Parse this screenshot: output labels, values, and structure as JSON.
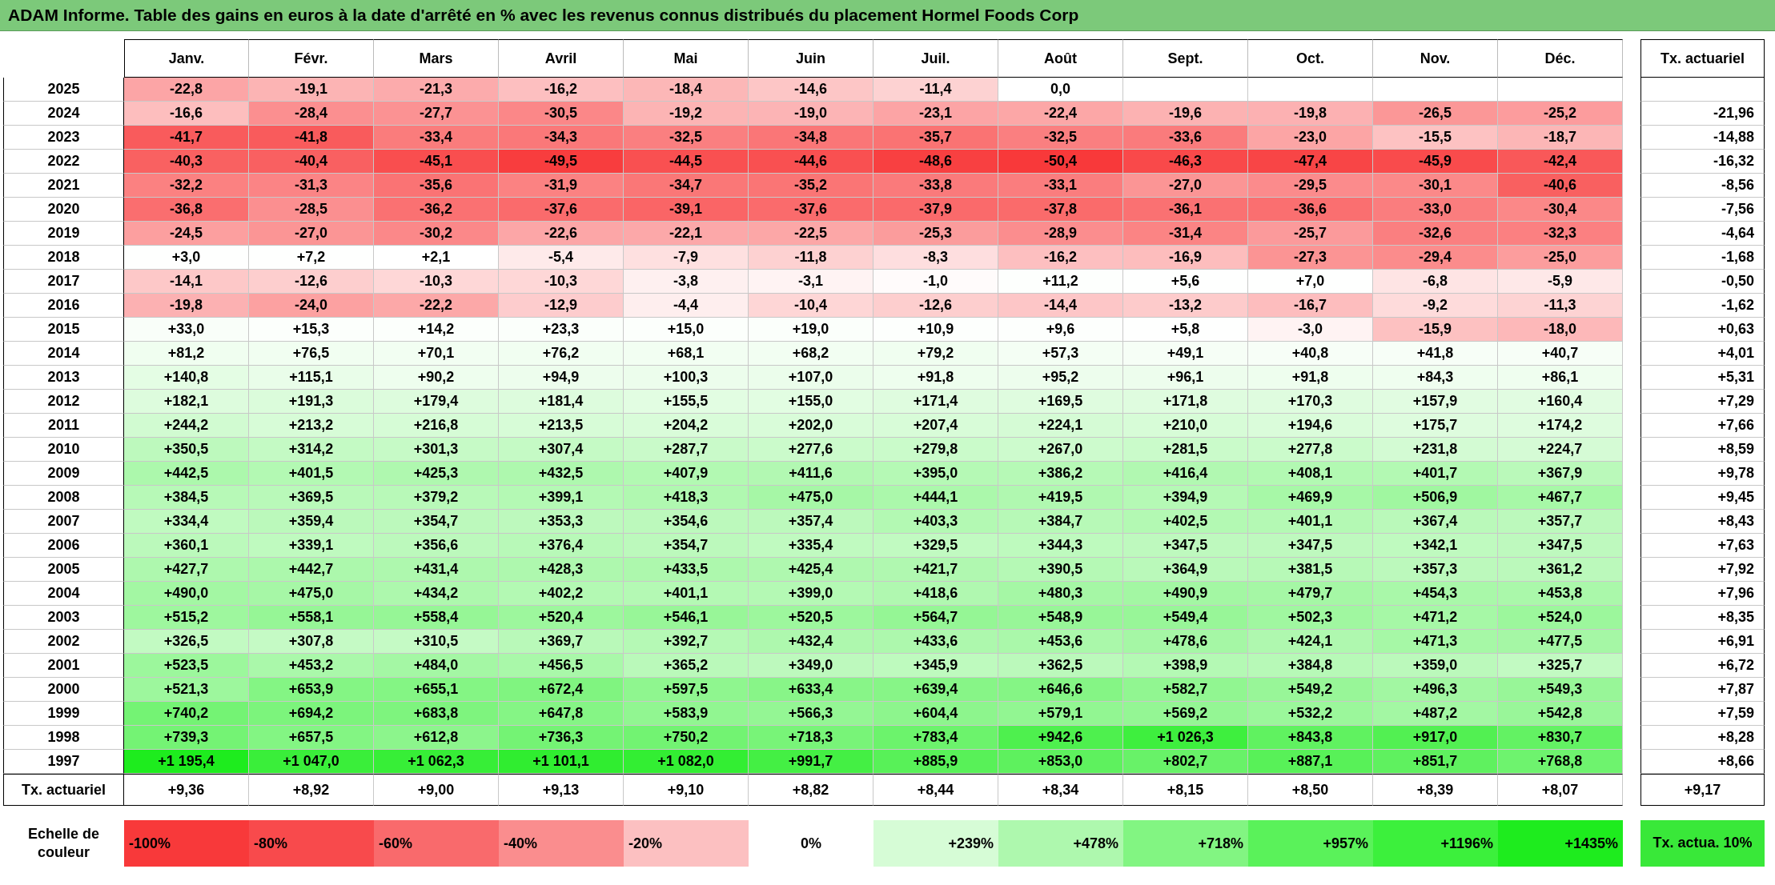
{
  "title": "ADAM Informe. Table des gains en euros à la date d'arrêté en % avec les revenus connus distribués du placement Hormel Foods Corp",
  "columns": [
    "Janv.",
    "Févr.",
    "Mars",
    "Avril",
    "Mai",
    "Juin",
    "Juil.",
    "Août",
    "Sept.",
    "Oct.",
    "Nov.",
    "Déc."
  ],
  "rate_header": "Tx. actuariel",
  "rows": [
    {
      "year": "2025",
      "values": [
        "-22,8",
        "-19,1",
        "-21,3",
        "-16,2",
        "-18,4",
        "-14,6",
        "-11,4",
        "0,0"
      ]
    },
    {
      "year": "2024",
      "values": [
        "-16,6",
        "-28,4",
        "-27,7",
        "-30,5",
        "-19,2",
        "-19,0",
        "-23,1",
        "-22,4",
        "-19,6",
        "-19,8",
        "-26,5",
        "-25,2"
      ],
      "rate": "-21,96"
    },
    {
      "year": "2023",
      "values": [
        "-41,7",
        "-41,8",
        "-33,4",
        "-34,3",
        "-32,5",
        "-34,8",
        "-35,7",
        "-32,5",
        "-33,6",
        "-23,0",
        "-15,5",
        "-18,7"
      ],
      "rate": "-14,88"
    },
    {
      "year": "2022",
      "values": [
        "-40,3",
        "-40,4",
        "-45,1",
        "-49,5",
        "-44,5",
        "-44,6",
        "-48,6",
        "-50,4",
        "-46,3",
        "-47,4",
        "-45,9",
        "-42,4"
      ],
      "rate": "-16,32"
    },
    {
      "year": "2021",
      "values": [
        "-32,2",
        "-31,3",
        "-35,6",
        "-31,9",
        "-34,7",
        "-35,2",
        "-33,8",
        "-33,1",
        "-27,0",
        "-29,5",
        "-30,1",
        "-40,6"
      ],
      "rate": "-8,56"
    },
    {
      "year": "2020",
      "values": [
        "-36,8",
        "-28,5",
        "-36,2",
        "-37,6",
        "-39,1",
        "-37,6",
        "-37,9",
        "-37,8",
        "-36,1",
        "-36,6",
        "-33,0",
        "-30,4"
      ],
      "rate": "-7,56"
    },
    {
      "year": "2019",
      "values": [
        "-24,5",
        "-27,0",
        "-30,2",
        "-22,6",
        "-22,1",
        "-22,5",
        "-25,3",
        "-28,9",
        "-31,4",
        "-25,7",
        "-32,6",
        "-32,3"
      ],
      "rate": "-4,64"
    },
    {
      "year": "2018",
      "values": [
        "+3,0",
        "+7,2",
        "+2,1",
        "-5,4",
        "-7,9",
        "-11,8",
        "-8,3",
        "-16,2",
        "-16,9",
        "-27,3",
        "-29,4",
        "-25,0"
      ],
      "rate": "-1,68"
    },
    {
      "year": "2017",
      "values": [
        "-14,1",
        "-12,6",
        "-10,3",
        "-10,3",
        "-3,8",
        "-3,1",
        "-1,0",
        "+11,2",
        "+5,6",
        "+7,0",
        "-6,8",
        "-5,9"
      ],
      "rate": "-0,50"
    },
    {
      "year": "2016",
      "values": [
        "-19,8",
        "-24,0",
        "-22,2",
        "-12,9",
        "-4,4",
        "-10,4",
        "-12,6",
        "-14,4",
        "-13,2",
        "-16,7",
        "-9,2",
        "-11,3"
      ],
      "rate": "-1,62"
    },
    {
      "year": "2015",
      "values": [
        "+33,0",
        "+15,3",
        "+14,2",
        "+23,3",
        "+15,0",
        "+19,0",
        "+10,9",
        "+9,6",
        "+5,8",
        "-3,0",
        "-15,9",
        "-18,0"
      ],
      "rate": "+0,63"
    },
    {
      "year": "2014",
      "values": [
        "+81,2",
        "+76,5",
        "+70,1",
        "+76,2",
        "+68,1",
        "+68,2",
        "+79,2",
        "+57,3",
        "+49,1",
        "+40,8",
        "+41,8",
        "+40,7"
      ],
      "rate": "+4,01"
    },
    {
      "year": "2013",
      "values": [
        "+140,8",
        "+115,1",
        "+90,2",
        "+94,9",
        "+100,3",
        "+107,0",
        "+91,8",
        "+95,2",
        "+96,1",
        "+91,8",
        "+84,3",
        "+86,1"
      ],
      "rate": "+5,31"
    },
    {
      "year": "2012",
      "values": [
        "+182,1",
        "+191,3",
        "+179,4",
        "+181,4",
        "+155,5",
        "+155,0",
        "+171,4",
        "+169,5",
        "+171,8",
        "+170,3",
        "+157,9",
        "+160,4"
      ],
      "rate": "+7,29"
    },
    {
      "year": "2011",
      "values": [
        "+244,2",
        "+213,2",
        "+216,8",
        "+213,5",
        "+204,2",
        "+202,0",
        "+207,4",
        "+224,1",
        "+210,0",
        "+194,6",
        "+175,7",
        "+174,2"
      ],
      "rate": "+7,66"
    },
    {
      "year": "2010",
      "values": [
        "+350,5",
        "+314,2",
        "+301,3",
        "+307,4",
        "+287,7",
        "+277,6",
        "+279,8",
        "+267,0",
        "+281,5",
        "+277,8",
        "+231,8",
        "+224,7"
      ],
      "rate": "+8,59"
    },
    {
      "year": "2009",
      "values": [
        "+442,5",
        "+401,5",
        "+425,3",
        "+432,5",
        "+407,9",
        "+411,6",
        "+395,0",
        "+386,2",
        "+416,4",
        "+408,1",
        "+401,7",
        "+367,9"
      ],
      "rate": "+9,78"
    },
    {
      "year": "2008",
      "values": [
        "+384,5",
        "+369,5",
        "+379,2",
        "+399,1",
        "+418,3",
        "+475,0",
        "+444,1",
        "+419,5",
        "+394,9",
        "+469,9",
        "+506,9",
        "+467,7"
      ],
      "rate": "+9,45"
    },
    {
      "year": "2007",
      "values": [
        "+334,4",
        "+359,4",
        "+354,7",
        "+353,3",
        "+354,6",
        "+357,4",
        "+403,3",
        "+384,7",
        "+402,5",
        "+401,1",
        "+367,4",
        "+357,7"
      ],
      "rate": "+8,43"
    },
    {
      "year": "2006",
      "values": [
        "+360,1",
        "+339,1",
        "+356,6",
        "+376,4",
        "+354,7",
        "+335,4",
        "+329,5",
        "+344,3",
        "+347,5",
        "+347,5",
        "+342,1",
        "+347,5"
      ],
      "rate": "+7,63"
    },
    {
      "year": "2005",
      "values": [
        "+427,7",
        "+442,7",
        "+431,4",
        "+428,3",
        "+433,5",
        "+425,4",
        "+421,7",
        "+390,5",
        "+364,9",
        "+381,5",
        "+357,3",
        "+361,2"
      ],
      "rate": "+7,92"
    },
    {
      "year": "2004",
      "values": [
        "+490,0",
        "+475,0",
        "+434,2",
        "+402,2",
        "+401,1",
        "+399,0",
        "+418,6",
        "+480,3",
        "+490,9",
        "+479,7",
        "+454,3",
        "+453,8"
      ],
      "rate": "+7,96"
    },
    {
      "year": "2003",
      "values": [
        "+515,2",
        "+558,1",
        "+558,4",
        "+520,4",
        "+546,1",
        "+520,5",
        "+564,7",
        "+548,9",
        "+549,4",
        "+502,3",
        "+471,2",
        "+524,0"
      ],
      "rate": "+8,35"
    },
    {
      "year": "2002",
      "values": [
        "+326,5",
        "+307,8",
        "+310,5",
        "+369,7",
        "+392,7",
        "+432,4",
        "+433,6",
        "+453,6",
        "+478,6",
        "+424,1",
        "+471,3",
        "+477,5"
      ],
      "rate": "+6,91"
    },
    {
      "year": "2001",
      "values": [
        "+523,5",
        "+453,2",
        "+484,0",
        "+456,5",
        "+365,2",
        "+349,0",
        "+345,9",
        "+362,5",
        "+398,9",
        "+384,8",
        "+359,0",
        "+325,7"
      ],
      "rate": "+6,72"
    },
    {
      "year": "2000",
      "values": [
        "+521,3",
        "+653,9",
        "+655,1",
        "+672,4",
        "+597,5",
        "+633,4",
        "+639,4",
        "+646,6",
        "+582,7",
        "+549,2",
        "+496,3",
        "+549,3"
      ],
      "rate": "+7,87"
    },
    {
      "year": "1999",
      "values": [
        "+740,2",
        "+694,2",
        "+683,8",
        "+647,8",
        "+583,9",
        "+566,3",
        "+604,4",
        "+579,1",
        "+569,2",
        "+532,2",
        "+487,2",
        "+542,8"
      ],
      "rate": "+7,59"
    },
    {
      "year": "1998",
      "values": [
        "+739,3",
        "+657,5",
        "+612,8",
        "+736,3",
        "+750,2",
        "+718,3",
        "+783,4",
        "+942,6",
        "+1 026,3",
        "+843,8",
        "+917,0",
        "+830,7"
      ],
      "rate": "+8,28"
    },
    {
      "year": "1997",
      "values": [
        "+1 195,4",
        "+1 047,0",
        "+1 062,3",
        "+1 101,1",
        "+1 082,0",
        "+991,7",
        "+885,9",
        "+853,0",
        "+802,7",
        "+887,1",
        "+851,7",
        "+768,8"
      ],
      "rate": "+8,66"
    }
  ],
  "summary": {
    "label": "Tx. actuariel",
    "values": [
      "+9,36",
      "+8,92",
      "+9,00",
      "+9,13",
      "+9,10",
      "+8,82",
      "+8,44",
      "+8,34",
      "+8,15",
      "+8,50",
      "+8,39",
      "+8,07"
    ],
    "rate": "+9,17"
  },
  "scale": {
    "label": "Echelle de couleur",
    "items": [
      {
        "label": "-100%",
        "kind": "negative",
        "color": "#f8393a"
      },
      {
        "label": "-80%",
        "kind": "negative",
        "color": "#f84a4c"
      },
      {
        "label": "-60%",
        "kind": "negative",
        "color": "#f96a6c"
      },
      {
        "label": "-40%",
        "kind": "negative",
        "color": "#fa8d8e"
      },
      {
        "label": "-20%",
        "kind": "negative",
        "color": "#fcc0c1"
      },
      {
        "label": "0%",
        "kind": "zero",
        "color": "#ffffff"
      },
      {
        "label": "+239%",
        "kind": "positive",
        "color": "#d6fcd6"
      },
      {
        "label": "+478%",
        "kind": "positive",
        "color": "#aef8ae"
      },
      {
        "label": "+718%",
        "kind": "positive",
        "color": "#82f582"
      },
      {
        "label": "+957%",
        "kind": "positive",
        "color": "#5af25a"
      },
      {
        "label": "+1196%",
        "kind": "positive",
        "color": "#3cf03c"
      },
      {
        "label": "+1435%",
        "kind": "positive",
        "color": "#1eec1e"
      }
    ],
    "rate": {
      "label": "Tx. actua. 10%",
      "color": "#39e839"
    }
  }
}
